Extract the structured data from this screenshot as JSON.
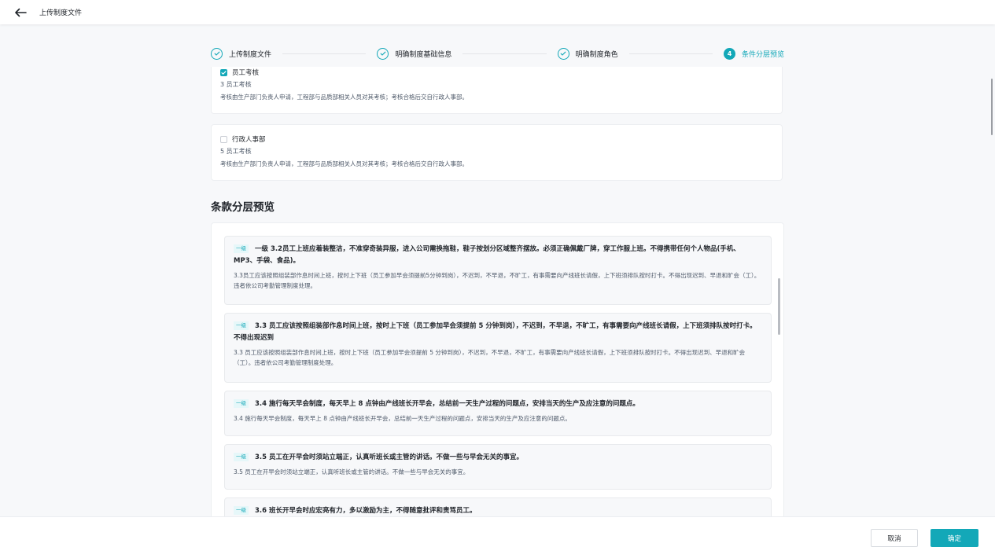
{
  "header": {
    "title": "上传制度文件"
  },
  "colors": {
    "accent": "#13a8b8"
  },
  "stepper": {
    "steps": [
      {
        "label": "上传制度文件",
        "status": "done"
      },
      {
        "label": "明确制度基础信息",
        "status": "done"
      },
      {
        "label": "明确制度角色",
        "status": "done"
      },
      {
        "number": "4",
        "label": "条件分层预览",
        "status": "active"
      }
    ]
  },
  "roles": [
    {
      "name": "员工考核",
      "checked": true,
      "sub": "3 员工考核",
      "desc": "考核由生产部门负责人申请，工程部与品质部相关人员对其考核；考核合格后交自行政人事部。"
    },
    {
      "name": "行政人事部",
      "checked": false,
      "sub": "5 员工考核",
      "desc": "考核由生产部门负责人申请，工程部与品质部相关人员对其考核；考核合格后交自行政人事部。"
    }
  ],
  "section": {
    "title": "条款分层预览"
  },
  "clauses": [
    {
      "level": "一级",
      "title": "一级 3.2员工上班应着装整洁，不准穿奇装异服，进入公司需换拖鞋，鞋子按划分区域整齐摆放。必须正确佩戴厂牌，穿工作服上班。不得携带任何个人物品(手机、MP3、手袋、食品)。",
      "body": "3.3员工应该按照组装部作息时间上班，按时上下班（员工参加早会须提前5分钟到岗），不迟到，不早退，不旷工，有事需要向产线班长请假，上下班须排队按时打卡。不得出现迟到、早退和旷会（工）。违者依公司考勤管理制度处理。"
    },
    {
      "level": "一级",
      "title": "3.3 员工应该按照组装部作息时间上班，按时上下班（员工参加早会须提前 5 分钟到岗），不迟到，不早退，不旷工，有事需要向产线班长请假，上下班须排队按时打卡。不得出现迟到",
      "body": "3.3 员工应该按照组装部作息时间上班，按时上下班（员工参加早会须提前 5 分钟到岗），不迟到，不早退，不旷工，有事需要向产线班长请假，上下班须排队按时打卡。不得出现迟到、早退和旷会（工）。违者依公司考勤管理制度处理。"
    },
    {
      "level": "一级",
      "title": "3.4 施行每天早会制度，每天早上 8 点钟由产线班长开早会，总结前一天生产过程的问题点，安排当天的生产及应注意的问题点。",
      "body": "3.4 施行每天早会制度，每天早上 8 点钟由产线班长开早会，总结前一天生产过程的问题点，安排当天的生产及应注意的问题点。"
    },
    {
      "level": "一级",
      "title": "3.5 员工在开早会时须站立端正，认真听班长或主管的讲话。不做一些与早会无关的事宜。",
      "body": "3.5 员工在开早会时须站立端正，认真听班长或主管的讲话。不做一些与早会无关的事宜。"
    },
    {
      "level": "一级",
      "title": "3.6 班长开早会时应宏亮有力，多以激励为主，不得随意批评和责骂员工。",
      "body": ""
    }
  ],
  "footer": {
    "cancel_label": "取消",
    "ok_label": "确定"
  }
}
